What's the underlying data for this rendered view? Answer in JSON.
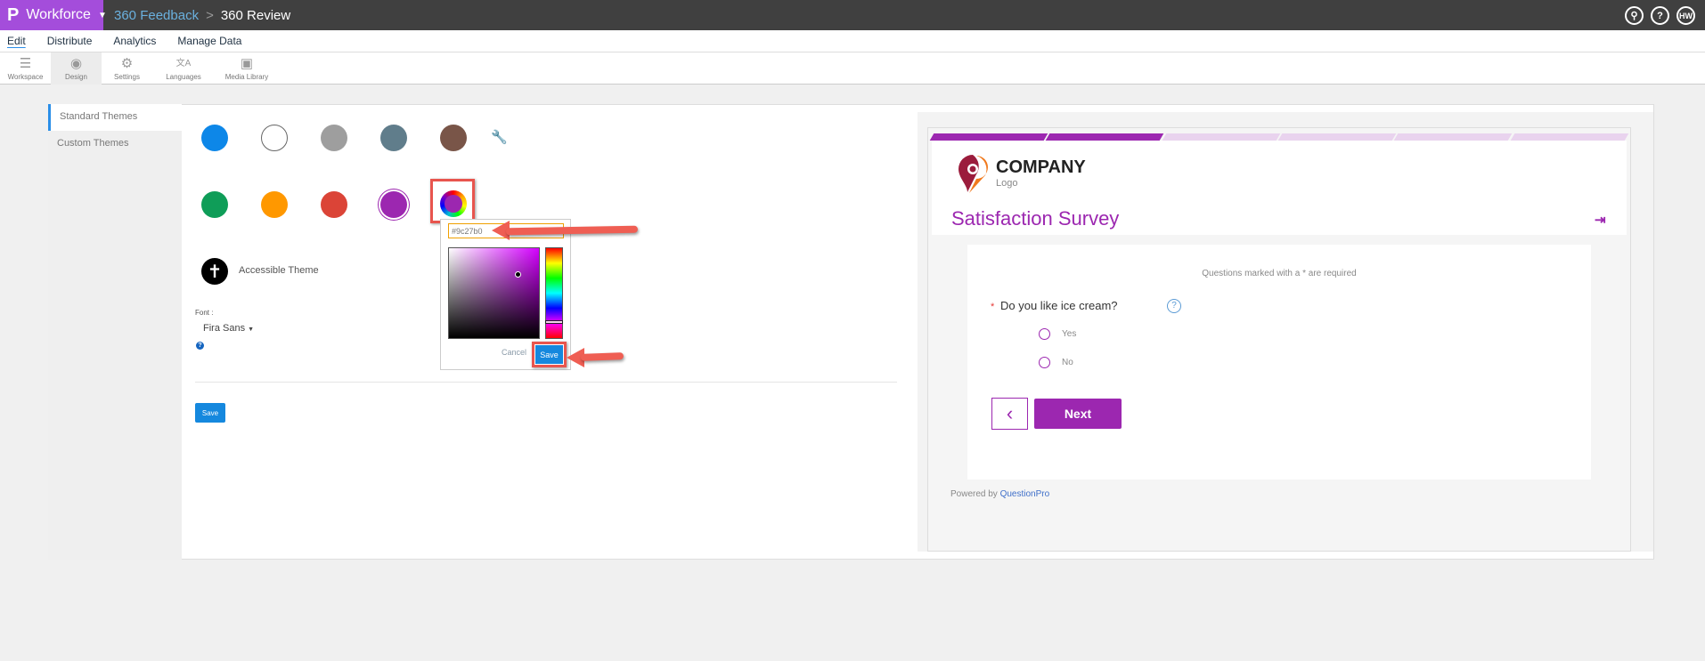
{
  "topbar": {
    "app": "Workforce",
    "crumb1": "360 Feedback",
    "sep": ">",
    "crumb2": "360 Review",
    "avatar": "HW"
  },
  "menu": [
    "Edit",
    "Distribute",
    "Analytics",
    "Manage Data"
  ],
  "toolbar": [
    "Workspace",
    "Design",
    "Settings",
    "Languages",
    "Media Library"
  ],
  "sidebar": {
    "standard": "Standard Themes",
    "custom": "Custom Themes"
  },
  "theme_colors": [
    "#0d87e8",
    "#ffffff",
    "#9e9e9e",
    "#607d8b",
    "#795548",
    "#0f9d58",
    "#ff9800",
    "#db4437",
    "#9c27b0"
  ],
  "selected_color": "#9c27b0",
  "accessible": "Accessible Theme",
  "font": {
    "label": "Font :",
    "value": "Fira Sans"
  },
  "picker": {
    "hex": "#9c27b0",
    "cancel": "Cancel",
    "save": "Save"
  },
  "save": "Save",
  "preview": {
    "company": "COMPANY",
    "logo": "Logo",
    "title": "Satisfaction Survey",
    "required_note": "Questions marked with a * are required",
    "asterisk": "*",
    "question": "Do you like ice cream?",
    "options": [
      "Yes",
      "No"
    ],
    "next": "Next",
    "powered": "Powered by",
    "brand": "QuestionPro",
    "progress_filled": 2,
    "progress_total": 6
  }
}
